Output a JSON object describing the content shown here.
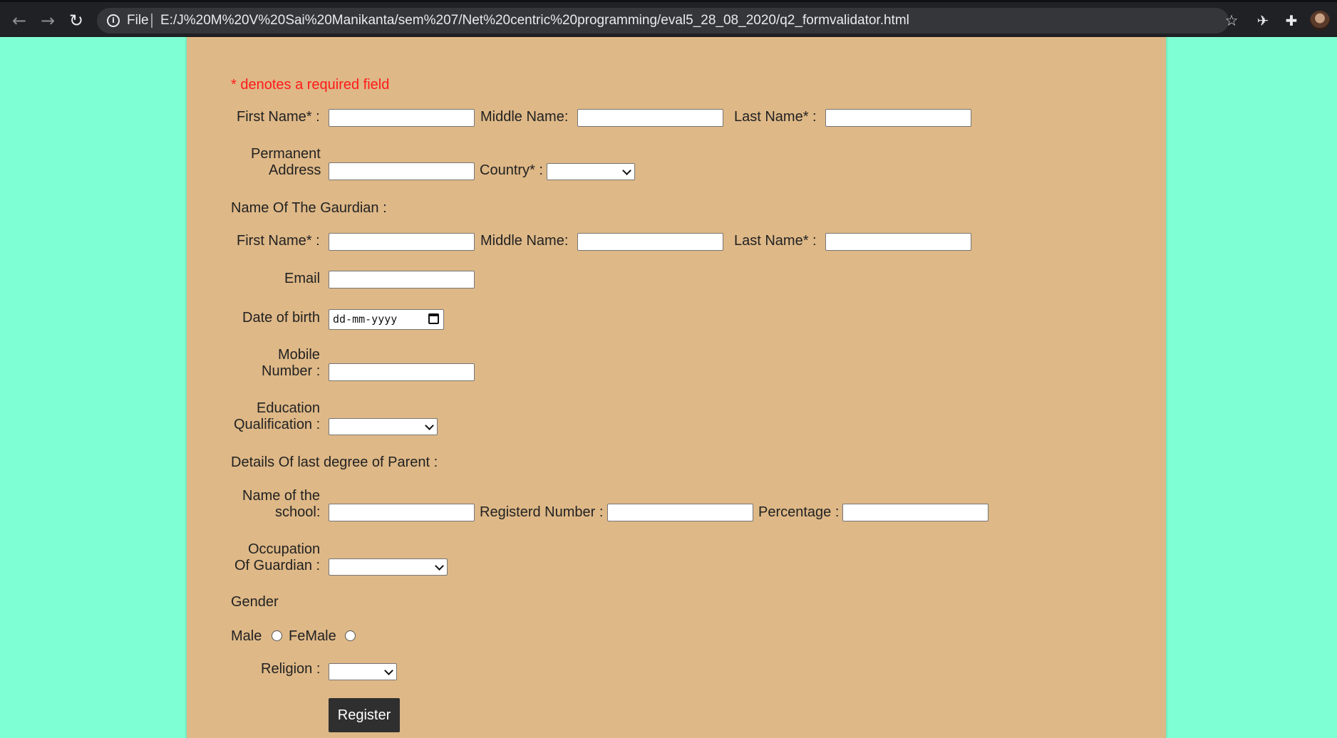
{
  "browser": {
    "scheme_label": "File",
    "url": "E:/J%20M%20V%20Sai%20Manikanta/sem%207/Net%20centric%20programming/eval5_28_08_2020/q2_formvalidator.html"
  },
  "form": {
    "required_note": "* denotes a required field",
    "first_name_label": "First Name* :",
    "middle_name_label": "Middle Name:",
    "last_name_label": "Last Name* :",
    "permanent_address_label_1": "Permanent",
    "permanent_address_label_2": "Address",
    "country_label": "Country* :",
    "guardian_heading": "Name Of The Gaurdian :",
    "guardian_first_label": "First Name* :",
    "guardian_middle_label": "Middle Name:",
    "guardian_last_label": "Last Name* :",
    "email_label": "Email",
    "dob_label": "Date of birth",
    "dob_placeholder": "dd-mm-yyyy",
    "mobile_label_1": "Mobile",
    "mobile_label_2": "Number :",
    "education_label_1": "Education",
    "education_label_2": "Qualification :",
    "parent_degree_heading": "Details Of last degree of Parent :",
    "school_label_1": "Name of the",
    "school_label_2": "school:",
    "reg_number_label": "Registerd Number :",
    "percentage_label": "Percentage :",
    "occupation_label_1": "Occupation",
    "occupation_label_2": "Of Guardian :",
    "gender_heading": "Gender",
    "male_label": "Male",
    "female_label": "FeMale",
    "religion_label": "Religion :",
    "register_button": "Register"
  }
}
